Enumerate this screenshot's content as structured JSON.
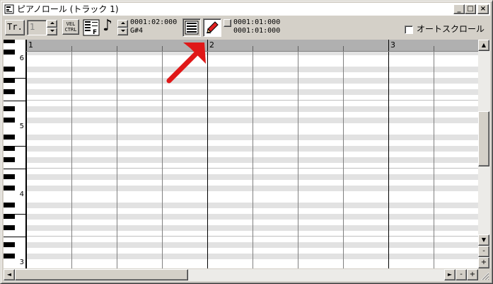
{
  "window": {
    "title": "ピアノロール (トラック 1)",
    "minimize_label": "_",
    "maximize_label": "□",
    "close_label": "×"
  },
  "toolbar": {
    "track_button_label": "Tr.",
    "track_number": "1",
    "vel_ctrl_label_top": "VEL",
    "vel_ctrl_label_bottom": "CTRL",
    "note_glyph": "♪",
    "position_time": "0001:02:000",
    "position_note": "G#4",
    "range_start": "0001:01:000",
    "range_end": "0001:01:000",
    "auto_scroll_label": "オートスクロール",
    "auto_scroll_checked": false
  },
  "ruler": {
    "measures": [
      "1",
      "2",
      "3"
    ]
  },
  "keyboard": {
    "octave_labels": [
      "6",
      "5",
      "4",
      "3"
    ]
  },
  "scrollbar": {
    "up": "▲",
    "down": "▼",
    "left": "◄",
    "right": "►",
    "zoom_out": "-",
    "zoom_in": "+"
  },
  "colors": {
    "black_key_lane": "#e2e2e2",
    "white_key_lane": "#ffffff",
    "measure_line": "#000000",
    "beat_line": "#808080",
    "arrow": "#e01818"
  }
}
